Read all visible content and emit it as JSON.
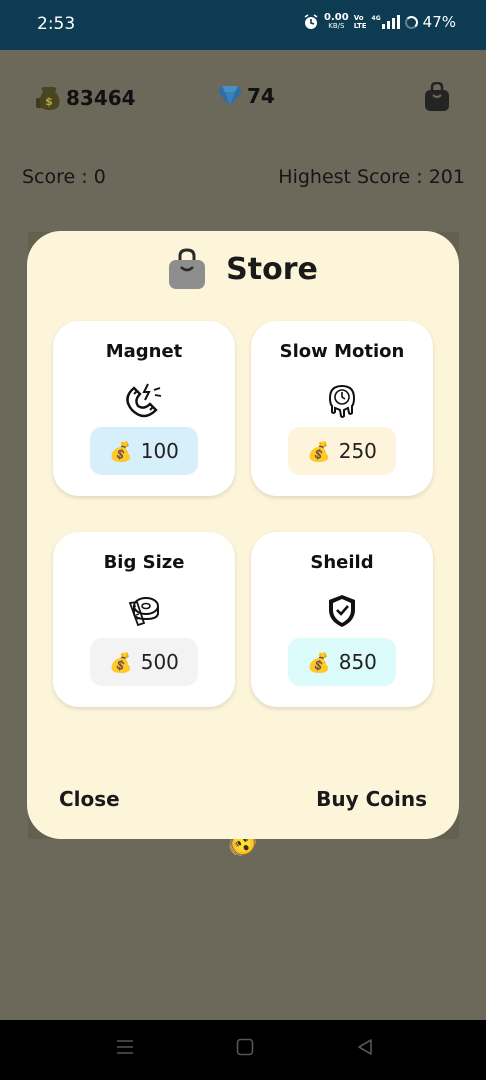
{
  "status_bar": {
    "time": "2:53",
    "net_speed": "0.00",
    "net_unit": "KB/S",
    "vo_top": "Vo",
    "vo_bottom": "LTE",
    "network_tag": "4G",
    "battery": "47%"
  },
  "hud": {
    "coins": "83464",
    "gems": "74",
    "score": "Score : 0",
    "highest_score": "Highest Score : 201"
  },
  "store": {
    "title": "Store",
    "items": [
      {
        "name": "Magnet",
        "price": "100",
        "price_bg": "#d7eefb",
        "icon": "magnet-icon"
      },
      {
        "name": "Slow Motion",
        "price": "250",
        "price_bg": "#fdf4db",
        "icon": "melting-clock-icon"
      },
      {
        "name": "Big Size",
        "price": "500",
        "price_bg": "#f3f3f3",
        "icon": "measuring-tape-icon"
      },
      {
        "name": "Sheild",
        "price": "850",
        "price_bg": "#dcfbfb",
        "icon": "shield-icon"
      }
    ],
    "close_label": "Close",
    "buy_coins_label": "Buy Coins"
  },
  "colors": {
    "status_bar": "#0d3b52",
    "overlay_bg": "#6c685a",
    "modal_bg": "#fdf5d9",
    "gem": "#2f80c9"
  }
}
